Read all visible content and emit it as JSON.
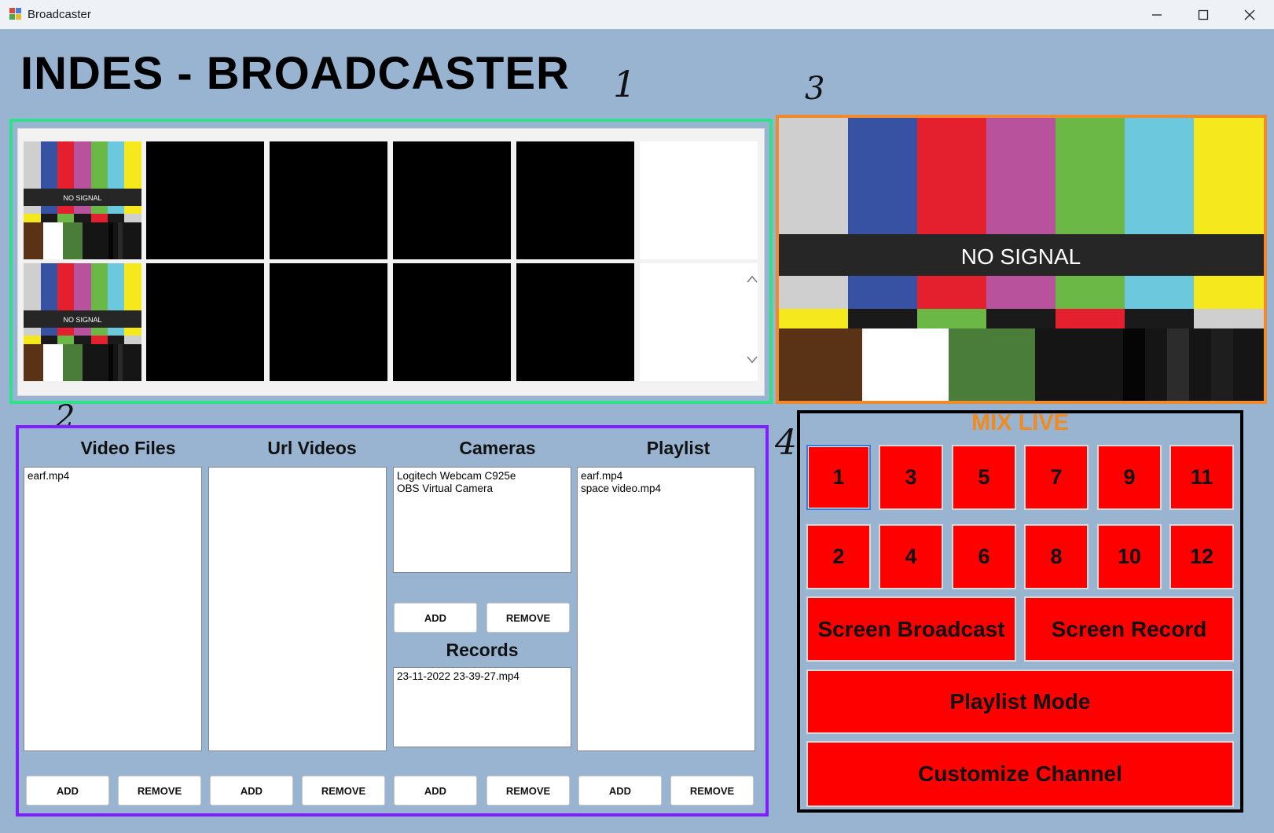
{
  "window": {
    "title": "Broadcaster"
  },
  "heading": "INDES - BROADCASTER",
  "annotations": [
    "1",
    "2",
    "3",
    "4"
  ],
  "colors": {
    "panel1_border": "#2ee28c",
    "panel2_border": "#7f1fff",
    "panel3_border": "#f08a2a",
    "panel4_border": "#000000",
    "mix_title": "#f28a1e",
    "mix_button": "#ff0000",
    "window_bg": "#99b4d1"
  },
  "preview": {
    "no_signal_small": "NO SIGNAL",
    "no_signal_large": "NO SIGNAL",
    "tiles": [
      "color-bars",
      "black",
      "black",
      "black",
      "black",
      "blank",
      "color-bars",
      "black",
      "black",
      "black",
      "black",
      "blank"
    ]
  },
  "sources": {
    "video_files": {
      "label": "Video Files",
      "items": [
        "earf.mp4"
      ],
      "add": "ADD",
      "remove": "REMOVE"
    },
    "url_videos": {
      "label": "Url Videos",
      "items": [],
      "add": "ADD",
      "remove": "REMOVE"
    },
    "cameras": {
      "label": "Cameras",
      "items": [
        "Logitech Webcam C925e",
        "OBS Virtual Camera"
      ],
      "add": "ADD",
      "remove": "REMOVE"
    },
    "records": {
      "label": "Records",
      "items": [
        "23-11-2022 23-39-27.mp4"
      ],
      "add": "ADD",
      "remove": "REMOVE"
    },
    "playlist": {
      "label": "Playlist",
      "items": [
        "earf.mp4",
        "space video.mp4"
      ],
      "add": "ADD",
      "remove": "REMOVE"
    }
  },
  "mix": {
    "title": "MIX LIVE",
    "row1": [
      "1",
      "3",
      "5",
      "7",
      "9",
      "11"
    ],
    "row2": [
      "2",
      "4",
      "6",
      "8",
      "10",
      "12"
    ],
    "selected": "1",
    "screen_broadcast": "Screen Broadcast",
    "screen_record": "Screen Record",
    "playlist_mode": "Playlist Mode",
    "customize_channel": "Customize Channel"
  }
}
